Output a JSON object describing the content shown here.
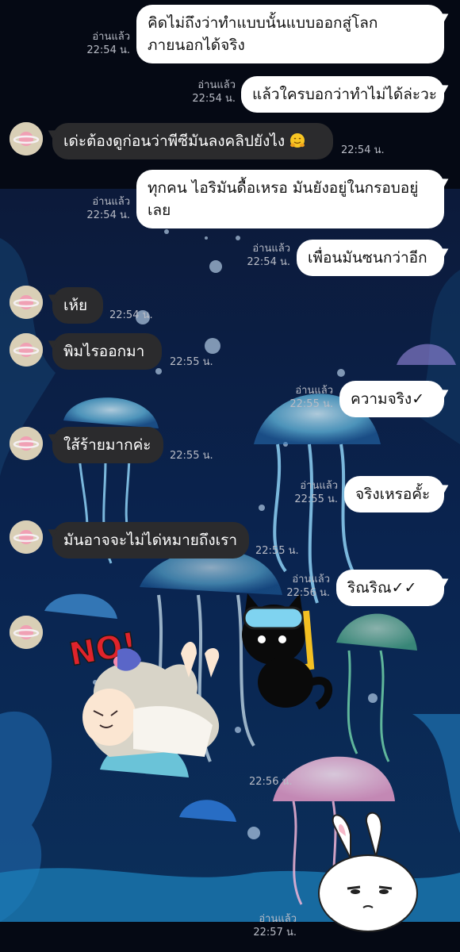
{
  "colors": {
    "background": "#060b1a",
    "outgoing_bubble": "#ffffff",
    "incoming_bubble": "#2b2b2d",
    "meta_text": "#b9bcc6"
  },
  "background_art": {
    "sign_text": "NO!"
  },
  "messages": [
    {
      "dir": "out",
      "lines": [
        "คิดไม่ถึงว่าทำแบบนั้นแบบออกสู่โลก",
        "ภายนอกได้จริง"
      ],
      "read": "อ่านแล้ว",
      "time": "22:54 น."
    },
    {
      "dir": "out",
      "lines": [
        "แล้วใครบอกว่าทำไม่ได้ล่ะวะ"
      ],
      "read": "อ่านแล้ว",
      "time": "22:54 น."
    },
    {
      "dir": "in",
      "text": "เด่ะต้องดูก่อนว่าพีซีมันลงคลิปยังไง",
      "emoji": "smiling-hands-emoji",
      "time": "22:54 น."
    },
    {
      "dir": "out",
      "lines": [
        "ทุกคน ไอริมันดื้อเหรอ มันยังอยู่ในกรอบอยู่",
        "เลย"
      ],
      "read": "อ่านแล้ว",
      "time": "22:54 น."
    },
    {
      "dir": "out",
      "lines": [
        "เพื่อนมันซนกว่าอีก"
      ],
      "read": "อ่านแล้ว",
      "time": "22:54 น."
    },
    {
      "dir": "in",
      "text": "เห้ย",
      "time": "22:54 น."
    },
    {
      "dir": "in",
      "text": "พิมไรออกมา",
      "time": "22:55 น."
    },
    {
      "dir": "out",
      "lines": [
        "ความจริง✓"
      ],
      "read": "อ่านแล้ว",
      "time": "22:55 น."
    },
    {
      "dir": "in",
      "text": "ใส้ร้ายมากค่ะ",
      "time": "22:55 น."
    },
    {
      "dir": "out",
      "lines": [
        "จริงเหรอคั้ะ"
      ],
      "read": "อ่านแล้ว",
      "time": "22:55 น."
    },
    {
      "dir": "in",
      "text": "มันอาจจะไม่ได่หมายถึงเรา",
      "time": "22:55 น."
    },
    {
      "dir": "out",
      "lines": [
        "ริณริณ✓✓"
      ],
      "read": "อ่านแล้ว",
      "time": "22:56 น."
    },
    {
      "dir": "in",
      "sticker": "anime-girl-no-sticker",
      "time": "22:56 น."
    },
    {
      "dir": "out",
      "sticker": "white-rabbit-sticker",
      "read": "อ่านแล้ว",
      "time": "22:57 น."
    }
  ]
}
